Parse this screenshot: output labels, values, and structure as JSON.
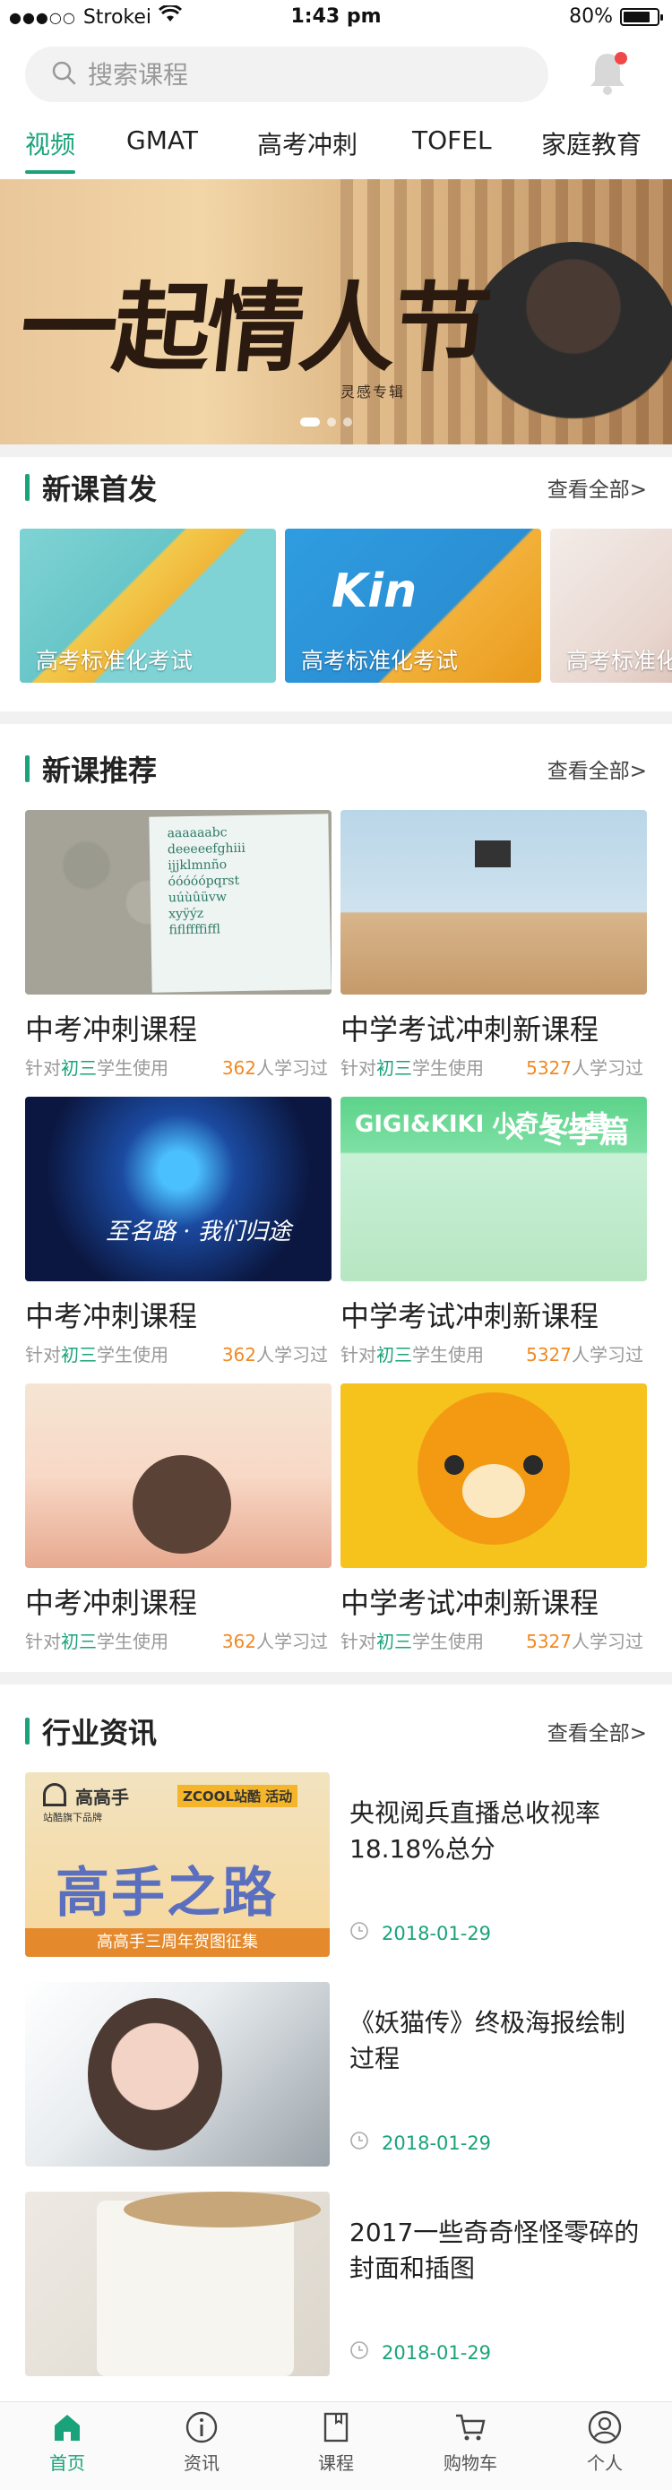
{
  "status_bar": {
    "carrier": "Strokei",
    "time": "1:43 pm",
    "battery": "80%",
    "battery_level": 0.8
  },
  "search": {
    "placeholder": "搜索课程"
  },
  "tabs": [
    {
      "label": "视频",
      "active": true
    },
    {
      "label": "GMAT",
      "active": false
    },
    {
      "label": "高考冲刺",
      "active": false
    },
    {
      "label": "TOFEL",
      "active": false
    },
    {
      "label": "家庭教育",
      "active": false
    }
  ],
  "banner": {
    "title": "一起情人节",
    "subtitle": "灵感专辑",
    "pages": 3,
    "current_page": 1
  },
  "new_courses": {
    "title": "新课首发",
    "more": "查看全部>",
    "items": [
      {
        "label": "高考标准化考试"
      },
      {
        "label": "高考标准化考试",
        "art_text": "Kin"
      },
      {
        "label": "高考标准化考试"
      }
    ]
  },
  "recommended": {
    "title": "新课推荐",
    "more": "查看全部>",
    "items": [
      {
        "name": "中考冲刺课程",
        "target_prefix": "针对",
        "target_grade": "初三",
        "target_suffix": "学生使用",
        "count": "362",
        "count_suffix": "人学习过",
        "art_text": "aaaaaabc\ndeeeeefghiii\nijjklmnño\nóóóóópqrst\nuúùûüvw\nxyÿýz\nfiflffffiffl"
      },
      {
        "name": "中学考试冲刺新课程",
        "target_prefix": "针对",
        "target_grade": "初三",
        "target_suffix": "学生使用",
        "count": "5327",
        "count_suffix": "人学习过"
      },
      {
        "name": "中考冲刺课程",
        "target_prefix": "针对",
        "target_grade": "初三",
        "target_suffix": "学生使用",
        "count": "362",
        "count_suffix": "人学习过",
        "art_text": "至名路 · 我们归途"
      },
      {
        "name": "中学考试冲刺新课程",
        "target_prefix": "针对",
        "target_grade": "初三",
        "target_suffix": "学生使用",
        "count": "5327",
        "count_suffix": "人学习过",
        "art_text": "GIGI&KIKI 小奇与小基",
        "art_text_2": "✕ 冬季篇"
      },
      {
        "name": "中考冲刺课程",
        "target_prefix": "针对",
        "target_grade": "初三",
        "target_suffix": "学生使用",
        "count": "362",
        "count_suffix": "人学习过"
      },
      {
        "name": "中学考试冲刺新课程",
        "target_prefix": "针对",
        "target_grade": "初三",
        "target_suffix": "学生使用",
        "count": "5327",
        "count_suffix": "人学习过"
      }
    ]
  },
  "news": {
    "title": "行业资讯",
    "more": "查看全部>",
    "items": [
      {
        "title": "央视阅兵直播总收视率18.18%总分",
        "date": "2018-01-29",
        "art_brand": "高高手",
        "art_brand_sub": "站酷旗下品牌",
        "art_tag": "ZCOOL站酷 活动",
        "art_title": "高手之路",
        "art_footer": "高高手三周年贺图征集"
      },
      {
        "title": "《妖猫传》终极海报绘制过程",
        "date": "2018-01-29"
      },
      {
        "title": "2017一些奇奇怪怪零碎的封面和插图",
        "date": "2018-01-29"
      }
    ]
  },
  "tabbar": [
    {
      "label": "首页",
      "icon": "home-icon",
      "active": true
    },
    {
      "label": "资讯",
      "icon": "info-icon",
      "active": false
    },
    {
      "label": "课程",
      "icon": "book-icon",
      "active": false
    },
    {
      "label": "购物车",
      "icon": "cart-icon",
      "active": false
    },
    {
      "label": "个人",
      "icon": "user-icon",
      "active": false
    }
  ],
  "colors": {
    "accent": "#1aa37a",
    "count": "#f08a24",
    "notification": "#f04848"
  }
}
